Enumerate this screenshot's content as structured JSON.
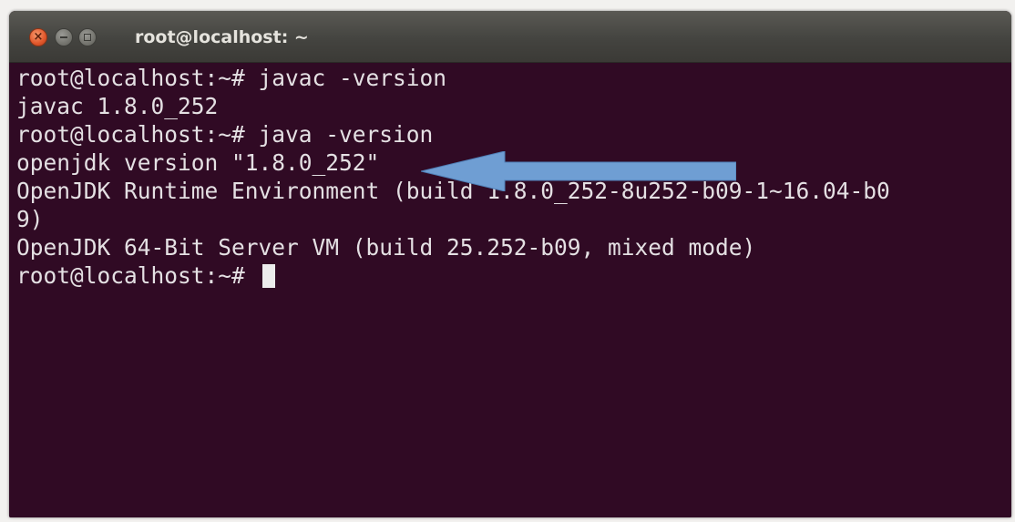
{
  "window": {
    "title": "root@localhost: ~",
    "buttons": [
      "close",
      "minimize",
      "maximize"
    ]
  },
  "terminal": {
    "lines": [
      "root@localhost:~# javac -version",
      "javac 1.8.0_252",
      "root@localhost:~# java -version",
      "openjdk version \"1.8.0_252\"",
      "OpenJDK Runtime Environment (build 1.8.0_252-8u252-b09-1~16.04-b0",
      "9)",
      "OpenJDK 64-Bit Server VM (build 25.252-b09, mixed mode)",
      "root@localhost:~# "
    ]
  },
  "colors": {
    "terminal_background": "#300a24",
    "terminal_text": "#e4e0e3",
    "titlebar": "#444440",
    "close_button": "#e0562a",
    "annotation_arrow": "#6f9ed3"
  },
  "annotation": {
    "icon": "left-arrow-icon",
    "points_to_line": 4
  }
}
